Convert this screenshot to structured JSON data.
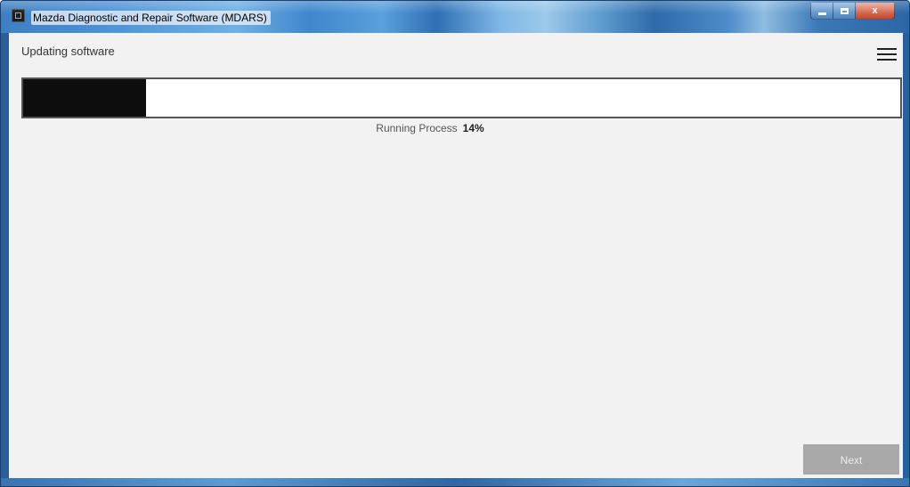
{
  "window": {
    "title": "Mazda Diagnostic and Repair Software (MDARS)",
    "app_icon": "mdars-app-icon",
    "controls": {
      "minimize_icon": "minimize-icon",
      "maximize_icon": "maximize-icon",
      "close_label": "x"
    }
  },
  "header": {
    "title": "Updating software",
    "menu_icon": "hamburger-menu-icon"
  },
  "progress": {
    "label": "Running Process",
    "percent_text": "14%",
    "value": 0.14,
    "fill_color": "#0d0d0d",
    "track_color": "#ffffff"
  },
  "footer": {
    "next_label": "Next",
    "next_enabled": false
  }
}
